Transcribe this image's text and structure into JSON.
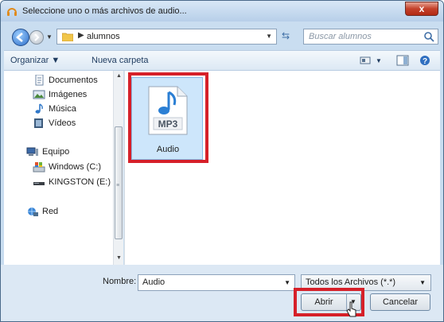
{
  "window": {
    "title": "Seleccione uno o más archivos de audio...",
    "close_glyph": "x"
  },
  "nav": {
    "path": "alumnos",
    "search_placeholder": "Buscar alumnos"
  },
  "toolbar": {
    "organize": "Organizar ▼",
    "new_folder": "Nueva carpeta"
  },
  "sidebar": {
    "items": [
      {
        "label": "Documentos",
        "icon": "document-icon"
      },
      {
        "label": "Imágenes",
        "icon": "image-icon"
      },
      {
        "label": "Música",
        "icon": "music-icon"
      },
      {
        "label": "Vídeos",
        "icon": "video-icon"
      },
      {
        "label": "Equipo",
        "icon": "computer-icon"
      },
      {
        "label": "Windows (C:)",
        "icon": "drive-icon"
      },
      {
        "label": "KINGSTON (E:)",
        "icon": "usb-drive-icon"
      },
      {
        "label": "Red",
        "icon": "network-icon"
      }
    ]
  },
  "files": [
    {
      "name": "Audio",
      "type_label": "MP3"
    }
  ],
  "footer": {
    "name_label": "Nombre:",
    "name_value": "Audio",
    "filter_value": "Todos los Archivos (*.*)",
    "open_label": "Abrir",
    "cancel_label": "Cancelar"
  },
  "colors": {
    "highlight_frame": "#d62029",
    "selection": "#cde6fb",
    "chrome": "#c9ddf0"
  }
}
